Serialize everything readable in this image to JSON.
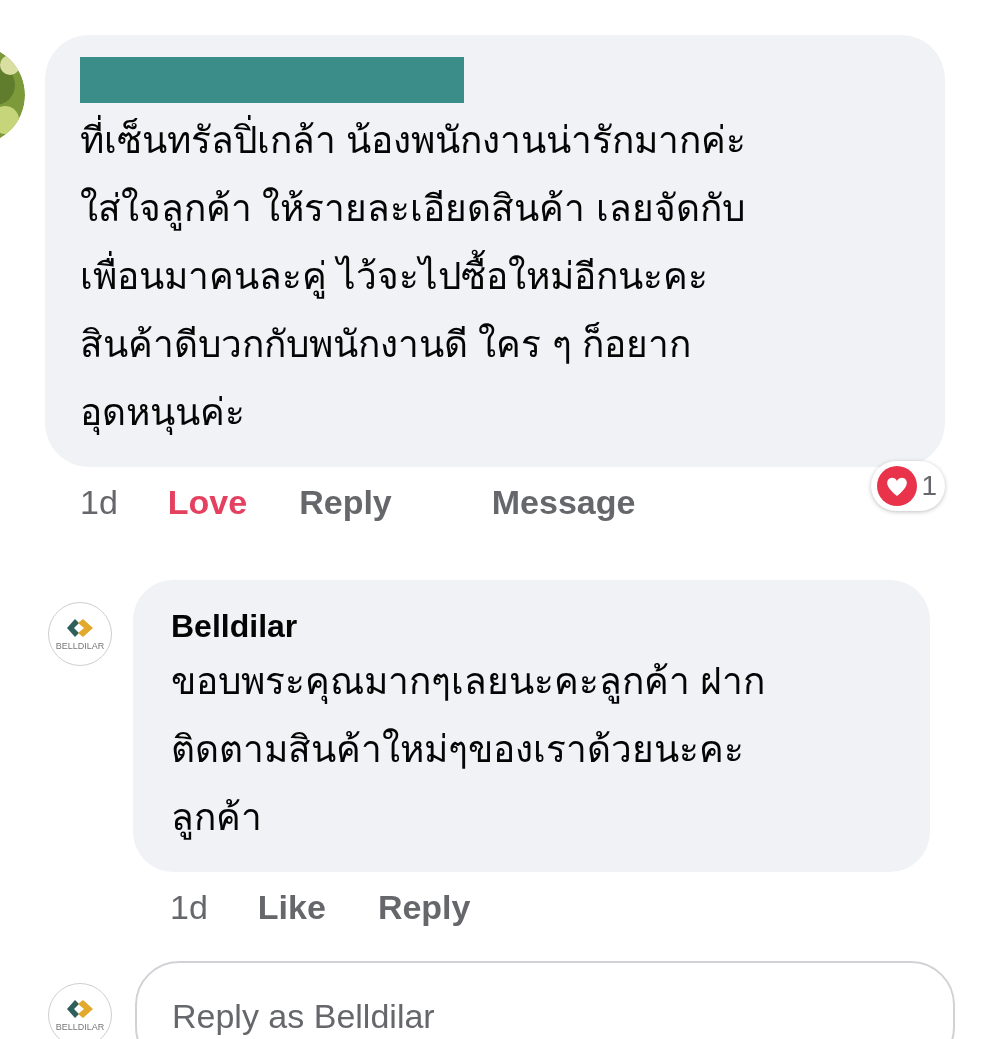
{
  "comments": [
    {
      "text": "ที่เซ็นทรัลปิ่เกล้า น้องพนักงานน่ารักมากค่ะ\nใส่ใจลูกค้า  ให้รายละเอียดสินค้า เลยจัดกับ\nเพื่อนมาคนละคู่ ไว้จะไปซื้อใหม่อีกนะคะ\nสินค้าดีบวกกับพนักงานดี ใคร ๆ ก็อยาก\nอุดหนุนค่ะ",
      "time": "1d",
      "actions": [
        {
          "label": "Love",
          "selected": true
        },
        {
          "label": "Reply",
          "selected": false
        },
        {
          "label": "Message",
          "selected": false
        }
      ],
      "reaction": {
        "count": "1"
      }
    },
    {
      "author": "Belldilar",
      "logo_text": "BELLDILAR",
      "text": "ขอบพระคุณมากๆเลยนะคะลูกค้า ฝาก\nติดตามสินค้าใหม่ๆของเราด้วยนะคะ\nลูกค้า",
      "time": "1d",
      "actions": [
        {
          "label": "Like",
          "selected": false
        },
        {
          "label": "Reply",
          "selected": false
        }
      ]
    }
  ],
  "reply_box": {
    "logo_text": "BELLDILAR",
    "placeholder": "Reply as Belldilar"
  }
}
